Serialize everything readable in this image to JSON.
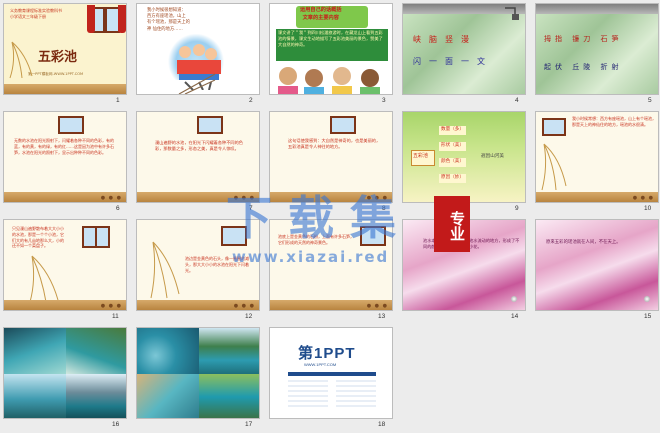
{
  "slides": [
    {
      "num": "1",
      "title": "五彩池",
      "header": "义务教育课程标准实验教科书\n小学语文三年级下册",
      "footer": "第一PPT模板网-WWW.1PPT.COM"
    },
    {
      "num": "2",
      "text": "我小时候很想知道：\n西方有座瑶池，山上\n有个瑶池，那是天上的\n神 仙住的地方……"
    },
    {
      "num": "3",
      "title": "运用自己的话概括\n文章的主要内容",
      "text": "课文讲了＂我＂到四川松潘旅游时，在藏龙山上看到五彩池的情景，课文生动地描写了五彩池美丽的景色，赞美了大自然的神奇。"
    },
    {
      "num": "4",
      "words": [
        "峡",
        "脑",
        "竖",
        "漫",
        "闪",
        "一",
        "面",
        "一",
        "文"
      ],
      "pinyin": [
        "xiá",
        "nǎo",
        "shù",
        "màn"
      ]
    },
    {
      "num": "5",
      "words": [
        "拇",
        "指",
        "镰",
        "刀",
        "石",
        "笋",
        "起",
        "伏",
        "丘",
        "陵",
        "折",
        "射"
      ]
    },
    {
      "num": "6",
      "text": "无数的水池在阳光照射下，闪耀着各种不同的色彩，有的蓝，有的黄，有的绿，有的红……这是因为池中有许多石笋，水池在阳光的照射下，显示出种种不同的色彩。"
    },
    {
      "num": "7",
      "text": "漫山遍野的水池，在阳光下闪耀着各种不同的色彩，那数量之多，形态之美，真是令人惊叹。"
    },
    {
      "num": "8",
      "text": "这句话使我感到：大自然是神奇的，也是美丽的，五彩池真是令人神往的地方。"
    },
    {
      "num": "9",
      "tag": "五彩池",
      "items": [
        "数量（多）",
        "形状（美）",
        "颜色（美）",
        "原因（妙）"
      ],
      "right": "遐因山河美"
    },
    {
      "num": "10",
      "text": "我小时候常想：西方有座瑶池，山上有个瑶池，那是天上的神仙住的地方，瑶池的水很清。"
    },
    {
      "num": "11",
      "text": "只见漫山遍野散布着大大小小的水池，那是一个个小池，它们大的有几亩地那么大，小的还不如一个菜盘子。"
    },
    {
      "num": "12",
      "text": "池边是金黄色的石头，像一圈圈的滩头，那大大小小的水池在阳光下闪着光。"
    },
    {
      "num": "13",
      "text": "池底上是金黄色的石粉，上面有许多石笋，它们形成的天然的神奇景色。"
    },
    {
      "num": "14",
      "text": "池水本来是无色透明的，池水流动的地方，形成了不同的颜色，池边有美丽的小花。"
    },
    {
      "num": "15",
      "text": "原来五彩的瑶池就在人间，不在天上。"
    },
    {
      "num": "16"
    },
    {
      "num": "17"
    },
    {
      "num": "18",
      "logo": "第1PPT",
      "sub": "WWW.1PPT.COM"
    }
  ],
  "watermark": {
    "title": "下载集",
    "badge": "专业",
    "url": "www.xiazai.red"
  }
}
